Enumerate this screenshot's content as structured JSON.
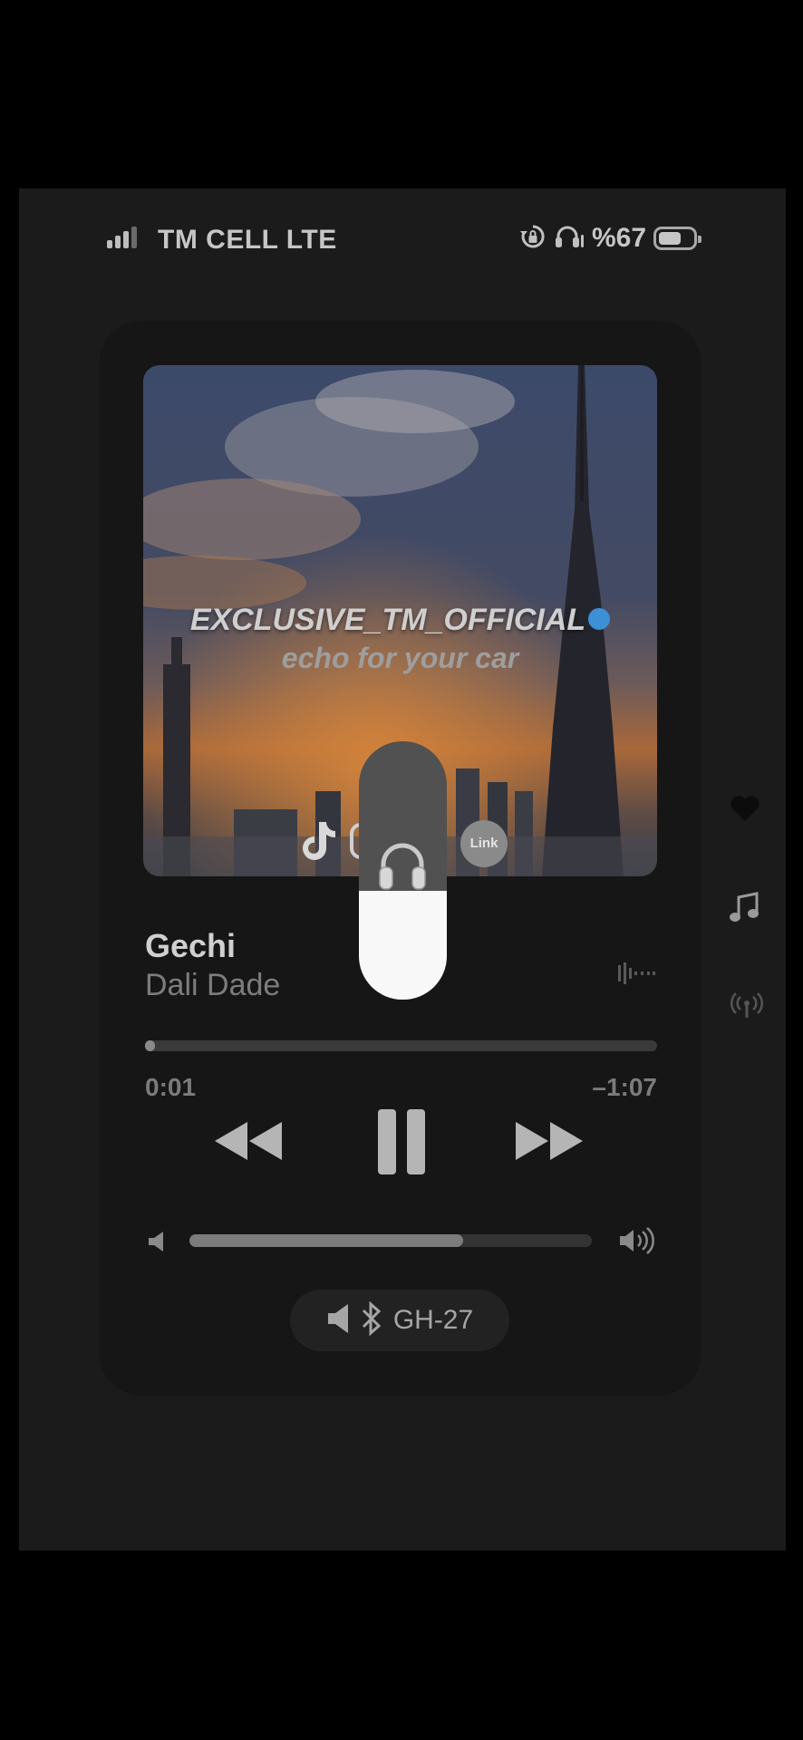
{
  "status_bar": {
    "carrier": "TM CELL LTE",
    "battery_text": "%67",
    "battery_level": 0.67,
    "icons": [
      "signal-icon",
      "rotation-lock-icon",
      "headphones-icon",
      "battery-icon"
    ]
  },
  "artwork": {
    "line1": "EXCLUSIVE_TM_OFFICIAL",
    "line2": "echo for your car",
    "link_label": "Link",
    "icons": [
      "tiktok-icon",
      "instagram-icon",
      "verified-badge-icon"
    ]
  },
  "track": {
    "title": "Gechi",
    "artist": "Dali Dade",
    "elapsed": "0:01",
    "remaining": "–1:07",
    "progress": 0.015
  },
  "controls": {
    "icons": [
      "rewind-icon",
      "pause-icon",
      "fast-forward-icon"
    ]
  },
  "volume": {
    "level": 0.68,
    "icons": [
      "speaker-low-icon",
      "speaker-high-icon"
    ]
  },
  "output": {
    "device": "GH-27",
    "icons": [
      "speaker-icon",
      "bluetooth-icon"
    ]
  },
  "side_icons": [
    "heart-icon",
    "music-note-icon",
    "broadcast-icon"
  ],
  "hud": {
    "level": 0.42,
    "icon": "headphones-icon"
  },
  "colors": {
    "background": "#000000",
    "screen": "#1b1b1b",
    "card": "#161616",
    "verified": "#3d8fd6",
    "hud_fill": "#f8f8f8"
  }
}
